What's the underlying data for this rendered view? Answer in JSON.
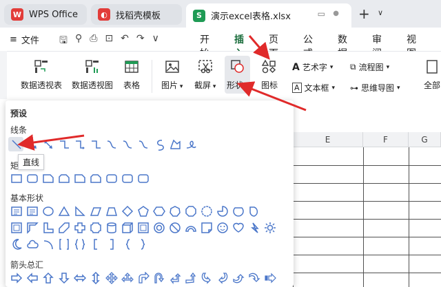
{
  "tabs": [
    {
      "label": "WPS Office",
      "icon": "W"
    },
    {
      "label": "找稻壳模板",
      "icon": "D"
    },
    {
      "label": "演示excel表格.xlsx",
      "icon": "S"
    }
  ],
  "menu": {
    "file": "文件",
    "tabs": [
      "开始",
      "插入",
      "页面",
      "公式",
      "数据",
      "审阅",
      "视图"
    ],
    "active_tab": "插入"
  },
  "ribbon": {
    "pivot_table": "数据透视表",
    "pivot_chart": "数据透视图",
    "table": "表格",
    "picture": "图片",
    "screenshot": "截屏",
    "shapes": "形状",
    "icons": "图标",
    "art_text": "艺术字",
    "text_box": "文本框",
    "flowchart": "流程图",
    "mindmap": "思维导图",
    "all": "全部"
  },
  "sheet": {
    "columns": [
      "E",
      "F",
      "G"
    ]
  },
  "panel": {
    "preset": "预设",
    "lines": "线条",
    "rect": "矩",
    "basic": "基本形状",
    "arrows": "箭头总汇",
    "tooltip": "直线"
  },
  "colors": {
    "accent_green": "#1f9b55",
    "arrow_red": "#e02a2a",
    "shape_blue": "#4a76c9"
  }
}
